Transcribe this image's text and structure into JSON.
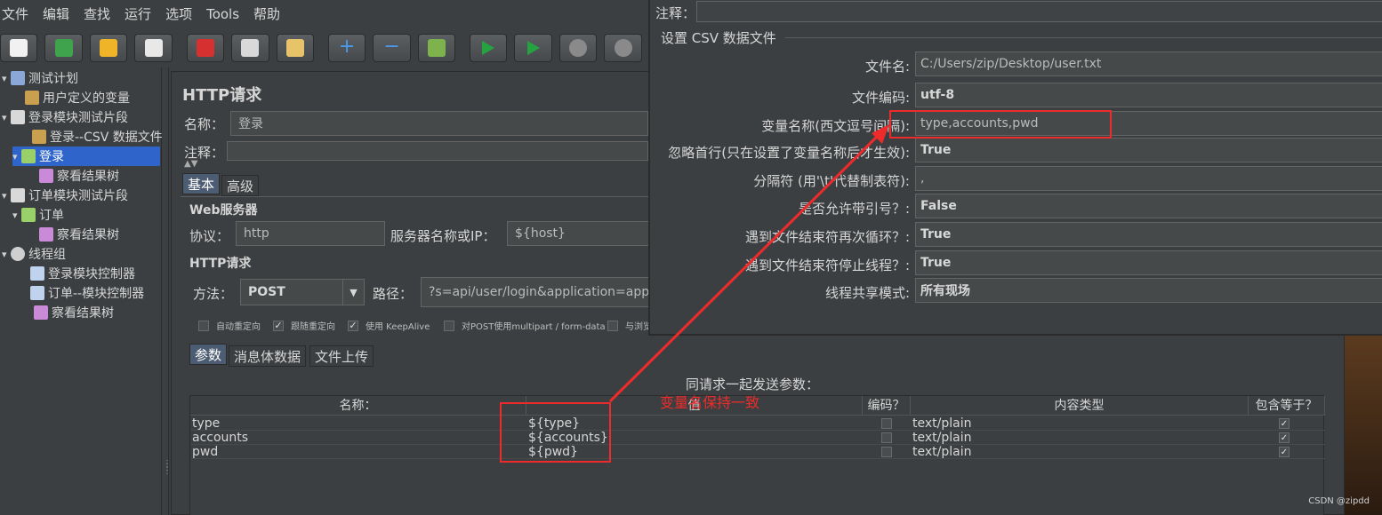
{
  "menu": [
    "文件",
    "编辑",
    "查找",
    "运行",
    "选项",
    "Tools",
    "帮助"
  ],
  "toolbar_icons": [
    "new-icon",
    "template-icon",
    "open-icon",
    "save-icon",
    "cut-icon",
    "copy-icon",
    "paste-icon",
    "expand-icon",
    "collapse-icon",
    "toggle-icon",
    "start-icon",
    "start-no-pause-icon",
    "stop-icon",
    "shutdown-icon"
  ],
  "tree": [
    {
      "label": "测试计划",
      "icon": "test-plan-icon",
      "toggle": "▾"
    },
    {
      "label": "用户定义的变量",
      "icon": "wrench-icon",
      "toggle": ""
    },
    {
      "label": "登录模块测试片段",
      "icon": "fragment-icon",
      "toggle": "▾"
    },
    {
      "label": "登录--CSV 数据文件",
      "icon": "wrench-icon",
      "toggle": ""
    },
    {
      "label": "登录",
      "icon": "sampler-icon",
      "toggle": "▾"
    },
    {
      "label": "察看结果树",
      "icon": "listener-icon",
      "toggle": ""
    },
    {
      "label": "订单模块测试片段",
      "icon": "fragment-icon",
      "toggle": "▾"
    },
    {
      "label": "订单",
      "icon": "sampler-icon",
      "toggle": "▾"
    },
    {
      "label": "察看结果树",
      "icon": "listener-icon",
      "toggle": ""
    },
    {
      "label": "线程组",
      "icon": "gear-icon",
      "toggle": "▾"
    },
    {
      "label": "登录模块控制器",
      "icon": "controller-icon",
      "toggle": ""
    },
    {
      "label": "订单--模块控制器",
      "icon": "controller-icon",
      "toggle": ""
    },
    {
      "label": "察看结果树",
      "icon": "listener-icon",
      "toggle": ""
    }
  ],
  "http": {
    "title": "HTTP请求",
    "name_label": "名称：",
    "name_value": "登录",
    "comment_label": "注释：",
    "tabs": [
      "基本",
      "高级"
    ],
    "web_server": "Web服务器",
    "protocol_label": "协议：",
    "protocol_value": "http",
    "server_label": "服务器名称或IP：",
    "server_value": "${host}",
    "request_group": "HTTP请求",
    "method_label": "方法：",
    "method_value": "POST",
    "path_label": "路径：",
    "path_value": "?s=api/user/login&application=app&app",
    "checkboxes": [
      {
        "label": "自动重定向",
        "checked": false
      },
      {
        "label": "跟随重定向",
        "checked": true
      },
      {
        "label": "使用 KeepAlive",
        "checked": true
      },
      {
        "label": "对POST使用multipart / form-data",
        "checked": false
      },
      {
        "label": "与浏览",
        "checked": false
      }
    ],
    "param_tabs": [
      "参数",
      "消息体数据",
      "文件上传"
    ],
    "params_title": "同请求一起发送参数：",
    "columns": [
      "名称：",
      "值",
      "编码？",
      "内容类型",
      "包含等于？"
    ],
    "rows": [
      {
        "name": "type",
        "value": "${type}",
        "encode": false,
        "content_type": "text/plain",
        "include_equals": true
      },
      {
        "name": "accounts",
        "value": "${accounts}",
        "encode": false,
        "content_type": "text/plain",
        "include_equals": true
      },
      {
        "name": "pwd",
        "value": "${pwd}",
        "encode": false,
        "content_type": "text/plain",
        "include_equals": true
      }
    ]
  },
  "csv": {
    "comment_label": "注释：",
    "group_title": "设置 CSV 数据文件",
    "rows": [
      {
        "label": "文件名:",
        "value": "C:/Users/zip/Desktop/user.txt",
        "bold": false
      },
      {
        "label": "文件编码:",
        "value": "utf-8",
        "bold": true
      },
      {
        "label": "变量名称(西文逗号间隔):",
        "value": "type,accounts,pwd",
        "bold": false
      },
      {
        "label": "忽略首行(只在设置了变量名称后才生效):",
        "value": "True",
        "bold": true
      },
      {
        "label": "分隔符 (用'\\t'代替制表符):",
        "value": ",",
        "bold": false
      },
      {
        "label": "是否允许带引号？:",
        "value": "False",
        "bold": true
      },
      {
        "label": "遇到文件结束符再次循环？:",
        "value": "True",
        "bold": true
      },
      {
        "label": "遇到文件结束符停止线程？:",
        "value": "True",
        "bold": true
      },
      {
        "label": "线程共享模式:",
        "value": "所有现场",
        "bold": true
      }
    ]
  },
  "annotation": "变量名保持一致",
  "watermark": "CSDN @zipdd",
  "colors": {
    "accent": "#2f65ca",
    "annotation_red": "#ee2b2b"
  }
}
